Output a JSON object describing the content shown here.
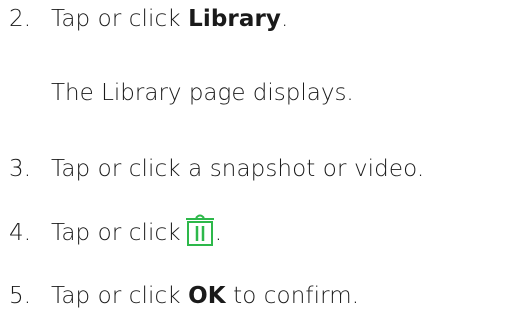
{
  "steps": [
    {
      "number": "2.",
      "prefix": "Tap or click ",
      "emphasis": "Library",
      "suffix": "."
    },
    {
      "note": "The Library page displays."
    },
    {
      "number": "3.",
      "text": "Tap or click a snapshot or video."
    },
    {
      "number": "4.",
      "prefix": "Tap or click",
      "icon": "trash-icon",
      "suffix": "."
    },
    {
      "number": "5.",
      "prefix": "Tap or click ",
      "emphasis": "OK",
      "suffix": " to confirm."
    }
  ],
  "colors": {
    "text": "#1a1a1a",
    "icon": "#2db84a"
  }
}
